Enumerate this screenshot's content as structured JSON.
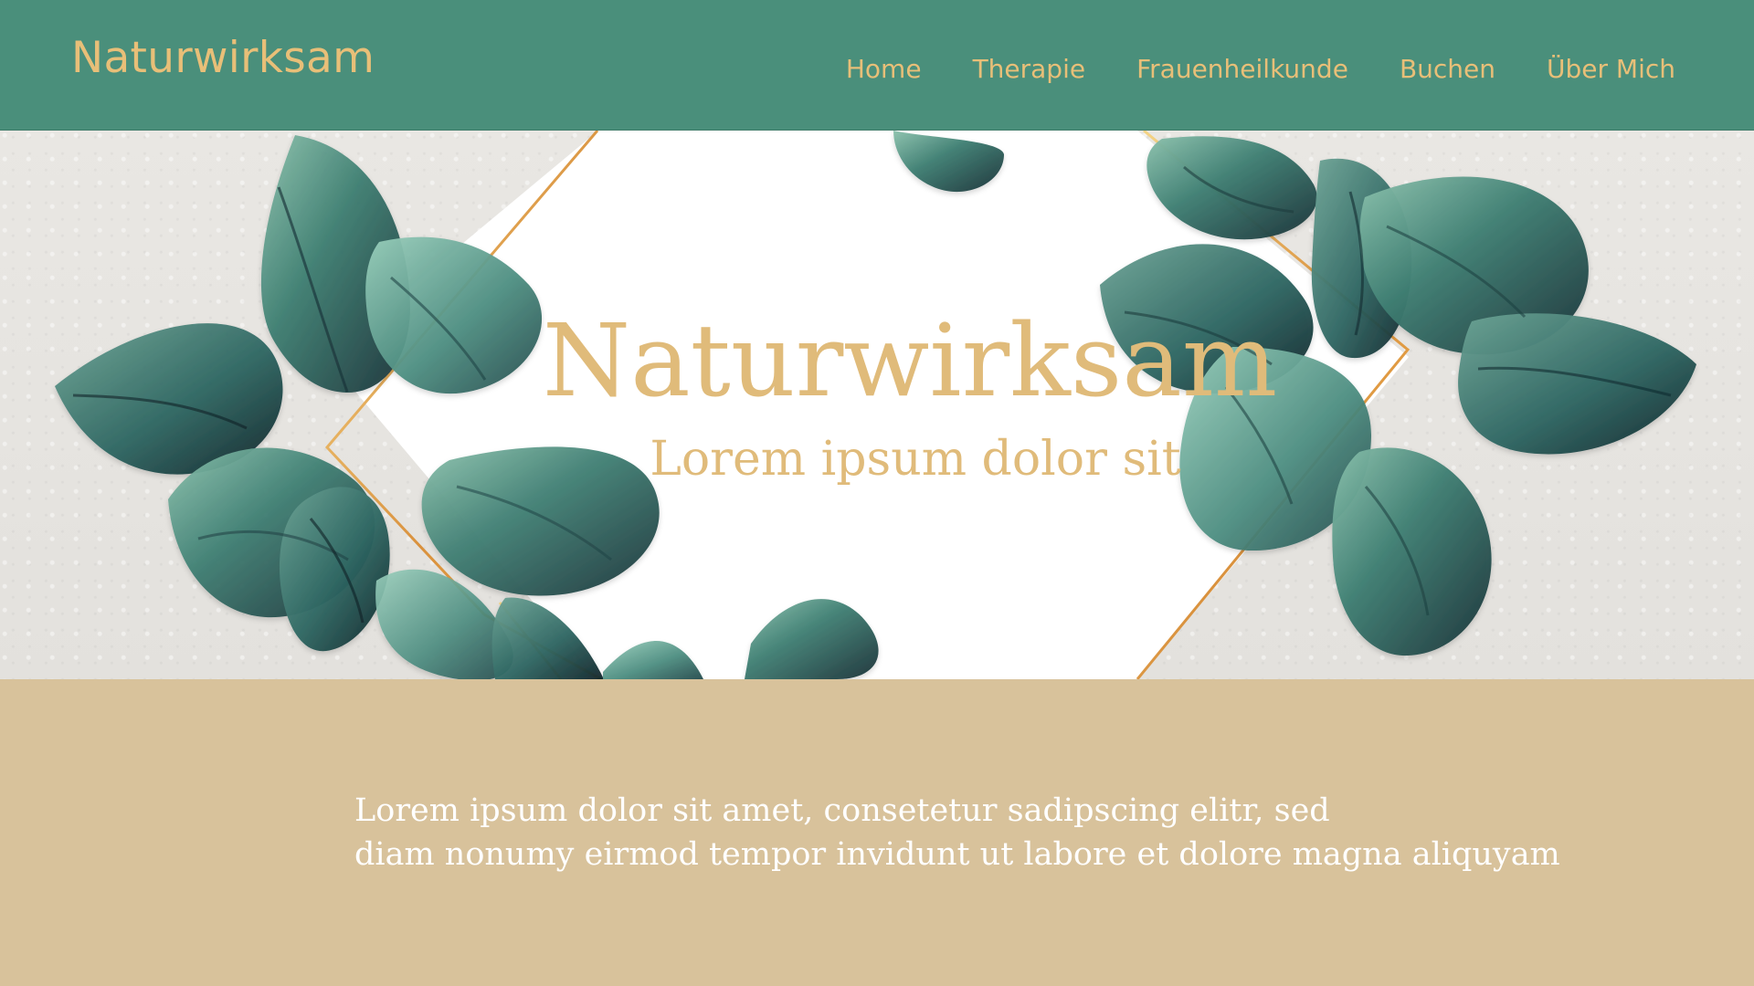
{
  "header": {
    "brand": "Naturwirksam",
    "nav": [
      "Home",
      "Therapie",
      "Frauenheilkunde",
      "Buchen",
      "Über Mich"
    ]
  },
  "hero": {
    "title": "Naturwirksam",
    "subtitle": "Lorem ipsum dolor sit"
  },
  "content": {
    "line1": "Lorem ipsum dolor sit amet, consetetur sadipscing elitr, sed",
    "line2": "diam nonumy eirmod tempor invidunt ut labore et dolore magna aliquyam"
  },
  "colors": {
    "header_bg": "#4a8f7b",
    "gold_text": "#e8bf78",
    "content_bg": "#d8c29b",
    "leaf_dark": "#26434a",
    "leaf_green": "#3f7f73"
  },
  "icons": [
    "watercolor-leaf-icon",
    "gold-frame-icon"
  ]
}
